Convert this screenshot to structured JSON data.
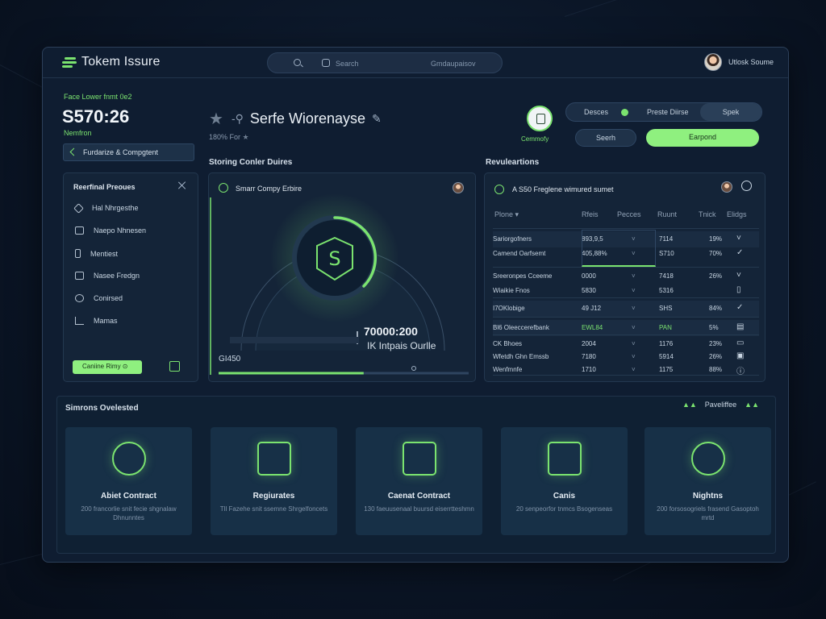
{
  "app": {
    "brand": "Tokem Issure"
  },
  "search": {
    "label": "Search",
    "secondary": "Gmdaupaisov"
  },
  "user": {
    "name": "Utlosk Soume"
  },
  "header": {
    "subtitle": "Face Lower fnmt 0e2",
    "value": "S570:26",
    "note": "Nemfron",
    "breadcrumb": "Furdarize & Compgtent",
    "title": "Serfe Wiorenayse",
    "title_sub": "180% For",
    "control_caption": "Cemmofy"
  },
  "segment": {
    "items": [
      "Desces",
      "Preste Diirse",
      "Spek"
    ]
  },
  "actions": {
    "secondary": "Seerh",
    "primary": "Earpond"
  },
  "sections": {
    "middle": "Storing Conler Duires",
    "right": "Revuleartions",
    "bottom": "Simrons Ovelested",
    "bottom_right": "Paveliffee"
  },
  "left_panel": {
    "title": "Reerfinal Preoues",
    "items": [
      {
        "label": "Hal Nhrgesthe",
        "icon": "diamond-icon"
      },
      {
        "label": "Naepo Nhnesen",
        "icon": "home-icon"
      },
      {
        "label": "Mentiest",
        "icon": "phone-icon"
      },
      {
        "label": "Nasee Fredgn",
        "icon": "wallet-icon"
      },
      {
        "label": "Conirsed",
        "icon": "search-icon"
      },
      {
        "label": "Mamas",
        "icon": "chart-icon"
      }
    ],
    "button": "Caniine Rimy"
  },
  "mid_panel": {
    "title": "Smarr Compy Erbire",
    "value": "70000:200",
    "caption": "IK Intpais Ourlle",
    "bottom_left": "GI450",
    "progress": 0.58
  },
  "right_panel": {
    "title": "A S50 Freglene wimured sumet",
    "columns": [
      "Plone",
      "Rfeis",
      "Pecces",
      "Ruunt",
      "Tnick",
      "Elidgs"
    ],
    "rows": [
      {
        "name": "Sariorgofners",
        "a": "893,9,5",
        "b": "7114",
        "c": "19%",
        "icon": "chevron-icon"
      },
      {
        "name": "Camend Oarfsemt",
        "a": "405,88%",
        "b": "S710",
        "c": "70%",
        "icon": "check-icon"
      },
      {
        "name": "Sreeronpes Cceeme",
        "a": "0000",
        "b": "7418",
        "c": "26%",
        "icon": "chevron-icon"
      },
      {
        "name": "Wiaikie Fnos",
        "a": "5830",
        "b": "5316",
        "c": "",
        "icon": "trash-icon"
      },
      {
        "name": "I7OKlobige",
        "a": "49 J12",
        "b": "SHS",
        "c": "84%",
        "icon": "check-icon"
      },
      {
        "name": "Bl6 Oleeccerefbank",
        "a": "EWL84",
        "b": "PAN",
        "c": "5%",
        "icon": "delete-icon"
      },
      {
        "name": "CK Bhoes",
        "a": "2004",
        "b": "1176",
        "c": "23%",
        "icon": "doc-icon"
      },
      {
        "name": "Wfetdh Ghn Emssb",
        "a": "7180",
        "b": "5914",
        "c": "26%",
        "icon": "calendar-icon"
      },
      {
        "name": "Wenfmnfe",
        "a": "1710",
        "b": "1175",
        "c": "88%",
        "icon": "info-icon"
      }
    ]
  },
  "cards": [
    {
      "name": "Abiet Contract",
      "desc": "200 francorlie snit fecie shgnalaw Dhnunntes",
      "icon": "dollar-coin-icon",
      "shape": "circle"
    },
    {
      "name": "Regiurates",
      "desc": "Tll Fazehe snit ssemne Shrgelfoncets",
      "icon": "briefcase-icon",
      "shape": "square"
    },
    {
      "name": "Caenat Contract",
      "desc": "130 faeuusenaal buursd eiserrtteshmn",
      "icon": "document-icon",
      "shape": "square"
    },
    {
      "name": "Canis",
      "desc": "20 senpeorfor tnmcs Bsogenseas",
      "icon": "funnel-icon",
      "shape": "square"
    },
    {
      "name": "Nightns",
      "desc": "200 forsosogriels frasend Gasoptoh mrtd",
      "icon": "shield-icon",
      "shape": "circle"
    }
  ],
  "colors": {
    "accent": "#7be36f",
    "panel": "#142438",
    "bg": "#0b1627"
  }
}
